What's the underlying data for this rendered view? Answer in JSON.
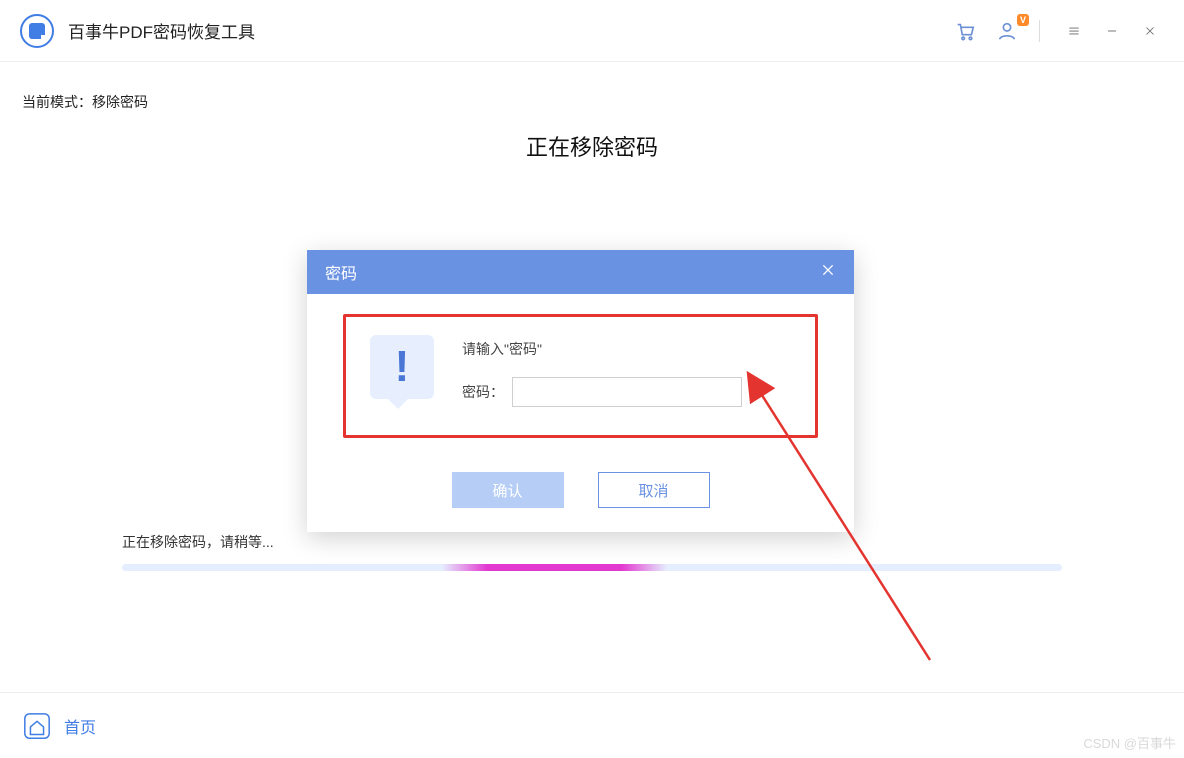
{
  "app": {
    "title": "百事牛PDF密码恢复工具"
  },
  "titlebar": {
    "vip_badge": "V"
  },
  "main": {
    "mode_label": "当前模式：",
    "mode_value": "移除密码",
    "heading": "正在移除密码"
  },
  "dialog": {
    "title": "密码",
    "alert_glyph": "!",
    "prompt": "请输入\"密码\"",
    "password_label": "密码：",
    "password_value": "",
    "confirm": "确认",
    "cancel": "取消"
  },
  "progress": {
    "text": "正在移除密码，请稍等..."
  },
  "footer": {
    "home": "首页"
  },
  "watermark": "CSDN @百事牛"
}
